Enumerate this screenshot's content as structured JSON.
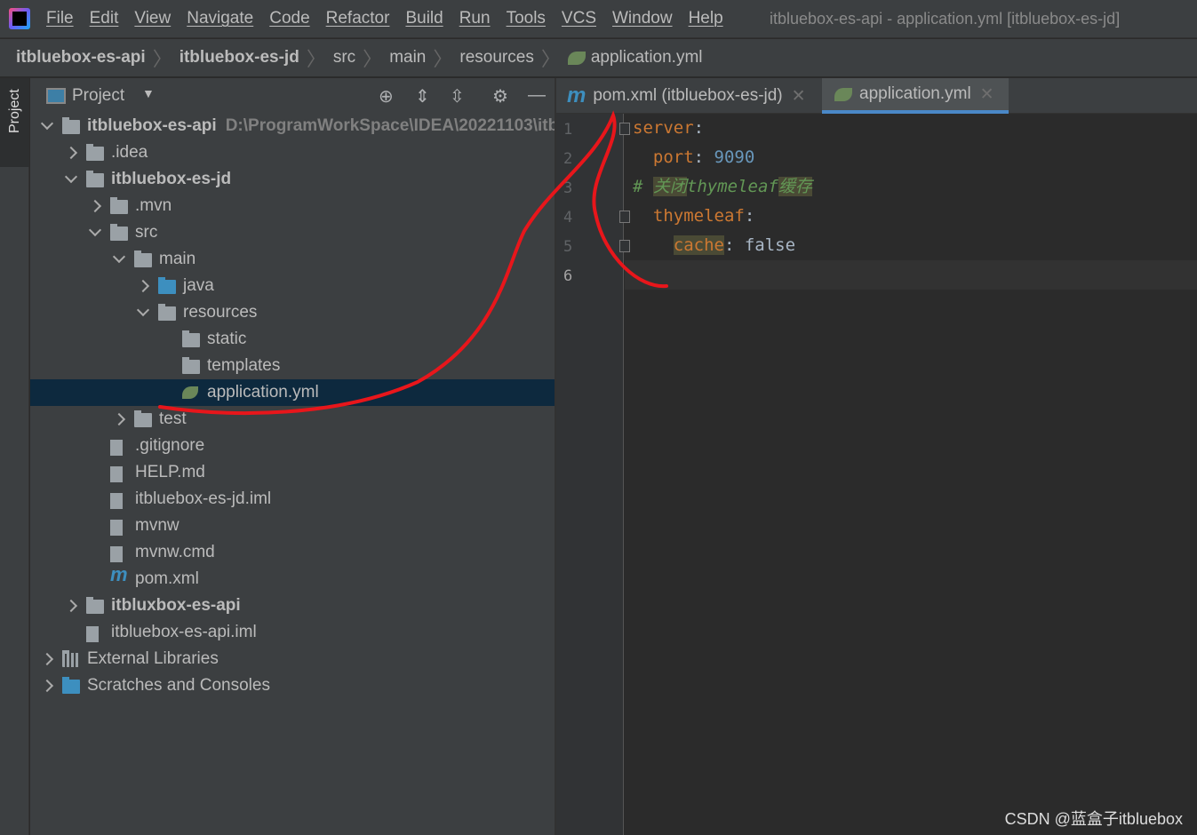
{
  "menubar": {
    "items": [
      "File",
      "Edit",
      "View",
      "Navigate",
      "Code",
      "Refactor",
      "Build",
      "Run",
      "Tools",
      "VCS",
      "Window",
      "Help"
    ],
    "title": "itbluebox-es-api - application.yml [itbluebox-es-jd]"
  },
  "breadcrumb": [
    {
      "label": "itbluebox-es-api",
      "bold": true
    },
    {
      "label": "itbluebox-es-jd",
      "bold": true
    },
    {
      "label": "src"
    },
    {
      "label": "main"
    },
    {
      "label": "resources"
    },
    {
      "label": "application.yml",
      "icon": "spring-icon"
    }
  ],
  "sidestrip": {
    "label": "Project"
  },
  "panel": {
    "title": "Project"
  },
  "tree": [
    {
      "label": "itbluebox-es-api",
      "path": "D:\\ProgramWorkSpace\\IDEA\\20221103\\itb",
      "level": 0,
      "state": "e",
      "icon": "module",
      "bold": true
    },
    {
      "label": ".idea",
      "level": 1,
      "state": "c",
      "icon": "folder"
    },
    {
      "label": "itbluebox-es-jd",
      "level": 1,
      "state": "e",
      "icon": "module",
      "bold": true
    },
    {
      "label": ".mvn",
      "level": 2,
      "state": "c",
      "icon": "folder"
    },
    {
      "label": "src",
      "level": 2,
      "state": "e",
      "icon": "folder"
    },
    {
      "label": "main",
      "level": 3,
      "state": "e",
      "icon": "folder"
    },
    {
      "label": "java",
      "level": 4,
      "state": "c",
      "icon": "blue"
    },
    {
      "label": "resources",
      "level": 4,
      "state": "e",
      "icon": "folder"
    },
    {
      "label": "static",
      "level": 5,
      "icon": "folder"
    },
    {
      "label": "templates",
      "level": 5,
      "icon": "folder"
    },
    {
      "label": "application.yml",
      "level": 5,
      "icon": "spring",
      "selected": true
    },
    {
      "label": "test",
      "level": 3,
      "state": "c",
      "icon": "folder"
    },
    {
      "label": ".gitignore",
      "level": 2,
      "icon": "file"
    },
    {
      "label": "HELP.md",
      "level": 2,
      "icon": "file"
    },
    {
      "label": "itbluebox-es-jd.iml",
      "level": 2,
      "icon": "file"
    },
    {
      "label": "mvnw",
      "level": 2,
      "icon": "file"
    },
    {
      "label": "mvnw.cmd",
      "level": 2,
      "icon": "file"
    },
    {
      "label": "pom.xml",
      "level": 2,
      "icon": "mvn"
    },
    {
      "label": "itbluxbox-es-api",
      "level": 1,
      "state": "c",
      "icon": "module",
      "bold": true
    },
    {
      "label": "itbluebox-es-api.iml",
      "level": 1,
      "icon": "file"
    },
    {
      "label": "External Libraries",
      "level": 0,
      "state": "c",
      "icon": "lib"
    },
    {
      "label": "Scratches and Consoles",
      "level": 0,
      "state": "c",
      "icon": "scratch"
    }
  ],
  "tabs": [
    {
      "label": "pom.xml (itbluebox-es-jd)",
      "icon": "maven-icon",
      "active": false
    },
    {
      "label": "application.yml",
      "icon": "spring-icon",
      "active": true
    }
  ],
  "editor": {
    "line_numbers": [
      "1",
      "2",
      "3",
      "4",
      "5",
      "6"
    ],
    "lines": [
      [
        {
          "t": "server",
          "c": "k"
        },
        {
          "t": ":",
          "c": "p"
        }
      ],
      [
        {
          "t": "  port",
          "c": "k"
        },
        {
          "t": ": ",
          "c": "p"
        },
        {
          "t": "9090",
          "c": "v"
        }
      ],
      [
        {
          "t": "# ",
          "c": "cm"
        },
        {
          "t": "关闭",
          "c": "cm hl"
        },
        {
          "t": "thymeleaf",
          "c": "cm"
        },
        {
          "t": "缓存",
          "c": "cm hl"
        }
      ],
      [
        {
          "t": "  thymeleaf",
          "c": "k"
        },
        {
          "t": ":",
          "c": "p"
        }
      ],
      [
        {
          "t": "    ",
          "c": "p"
        },
        {
          "t": "cache",
          "c": "k hl"
        },
        {
          "t": ": false",
          "c": "p"
        }
      ],
      []
    ]
  },
  "watermark": "CSDN @蓝盒子itbluebox",
  "colors": {
    "annotation": "#e8161b",
    "accent": "#4a88c7"
  }
}
